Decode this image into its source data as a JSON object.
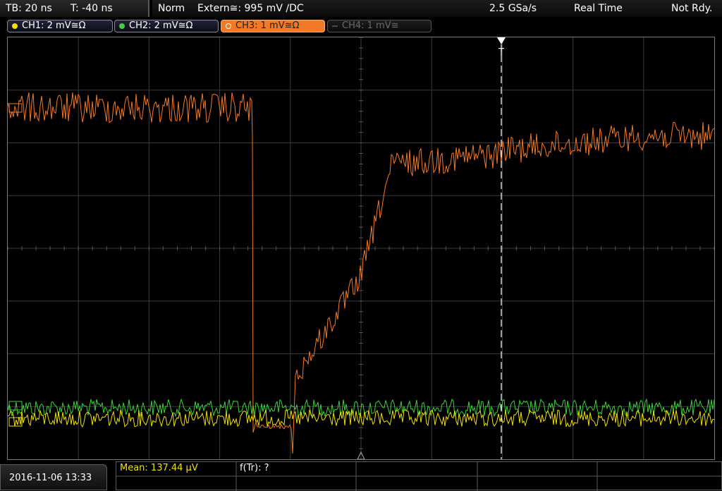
{
  "timebase": {
    "tb_label": "TB: 20 ns",
    "trigger_offset": "T: -40 ns"
  },
  "status": {
    "mode": "Norm",
    "trigger_source": "Extern≅: 995 mV ∕DC",
    "sample_rate": "2.5 GSa/s",
    "acquisition": "Real Time",
    "ready_state": "Not Rdy."
  },
  "channels": [
    {
      "label": "CH1: 2 mV≅Ω",
      "color": "#f0e000",
      "state": "on"
    },
    {
      "label": "CH2: 2 mV≅Ω",
      "color": "#40d040",
      "state": "on"
    },
    {
      "label": "CH3: 1 mV≅Ω",
      "color": "#f07a28",
      "state": "selected"
    },
    {
      "label": "CH4: 1 mV≅",
      "color": "#6a6a6a",
      "state": "off"
    }
  ],
  "trigger_marker": {
    "label": "T"
  },
  "timestamp": "2016-11-06 13:33",
  "measurements": {
    "mean": "Mean: 137.44 µV",
    "rise_freq": "f(Tr): ?"
  }
}
